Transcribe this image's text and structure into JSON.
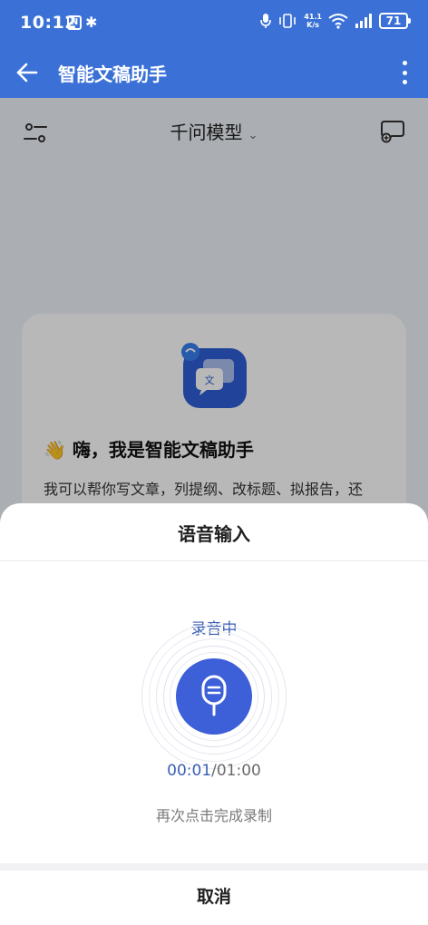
{
  "status_bar": {
    "time": "10:12",
    "nfc_label": "N",
    "bluetooth_glyph": "✱",
    "net_speed_value": "41.1",
    "net_speed_unit": "K/s",
    "battery": "71"
  },
  "app_bar": {
    "title": "智能文稿助手",
    "back_icon": "arrow-left-icon",
    "menu_icon": "more-vertical-icon"
  },
  "page": {
    "model_selector": "千问模型",
    "welcome": {
      "greeting": "👋 嗨，我是智能文稿助手",
      "intro": "我可以帮你写文章，列提纲、改标题、拟报告，还"
    }
  },
  "voice_sheet": {
    "title": "语音输入",
    "status": "录音中",
    "elapsed": "00:01",
    "total": "/01:00",
    "hint": "再次点击完成录制",
    "cancel_label": "取消"
  },
  "colors": {
    "brand_blue": "#3b71d6",
    "mic_blue": "#3d5fd8",
    "status_text": "#3b5fb5"
  }
}
